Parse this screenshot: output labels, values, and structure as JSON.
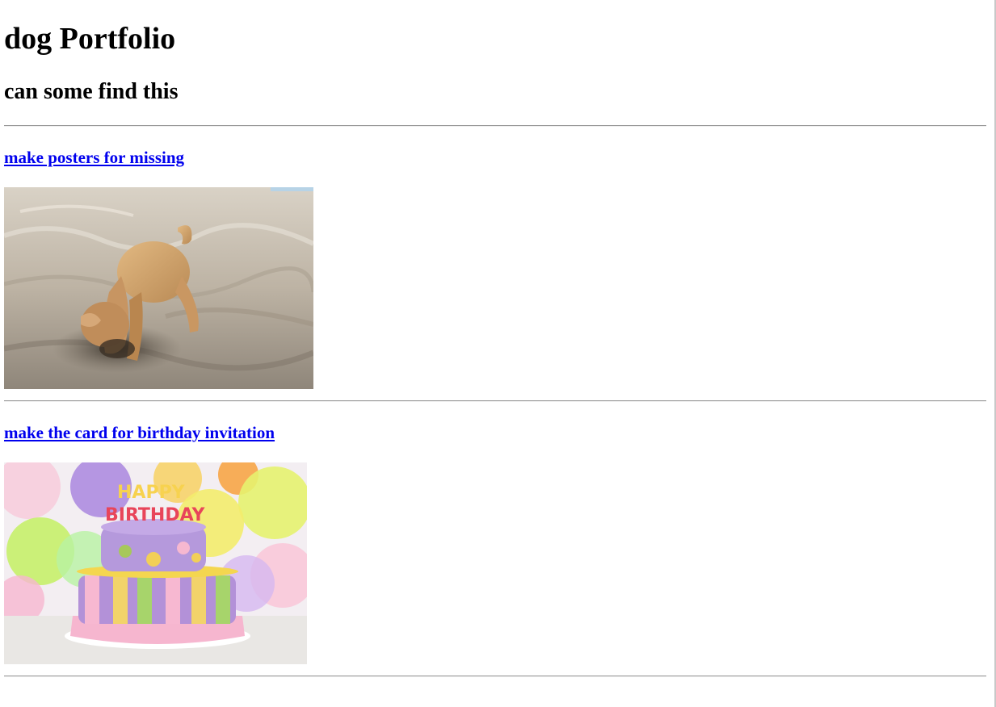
{
  "header": {
    "title": "dog Portfolio",
    "subtitle": "can some find this"
  },
  "items": [
    {
      "link_label": "make posters for missing",
      "image_icon": "dog-digging-in-sand-photo"
    },
    {
      "link_label": "make the card for birthday invitation",
      "image_icon": "birthday-cake-with-balloons-photo",
      "candle_letters_top": "HAPPY",
      "candle_letters_bottom": "BIRTHDAY"
    }
  ],
  "colors": {
    "link": "#0000ee",
    "rule": "#9a9a9a",
    "background": "#ffffff"
  }
}
